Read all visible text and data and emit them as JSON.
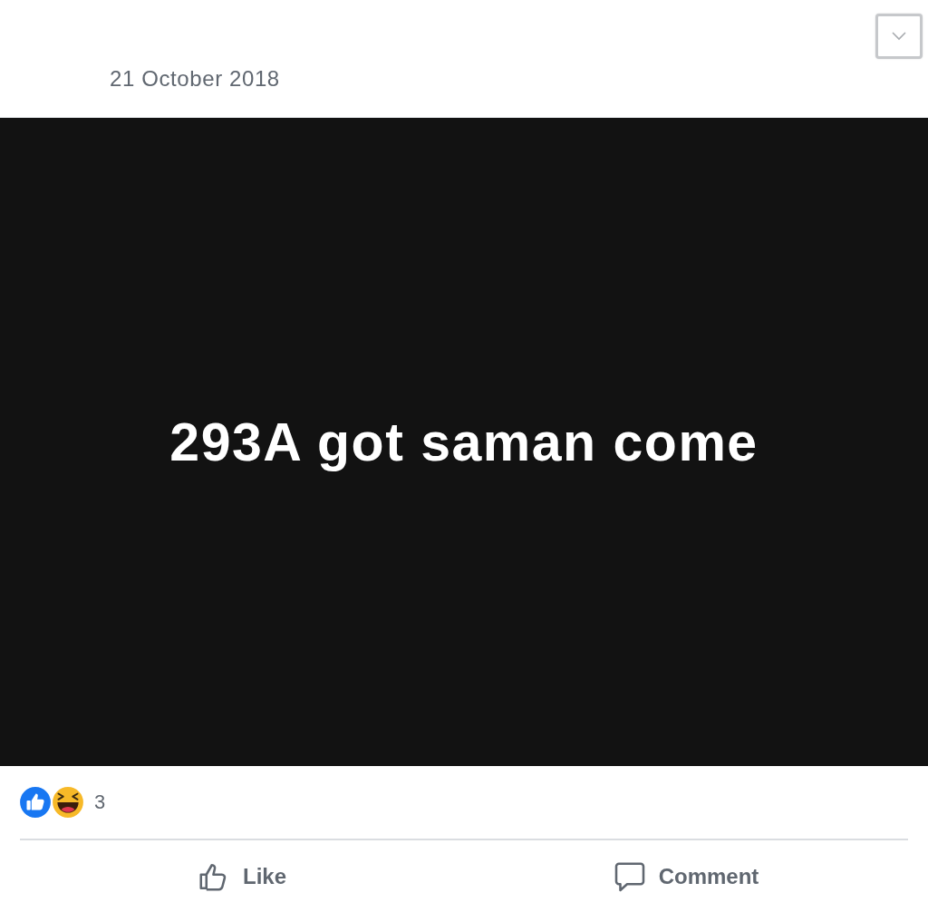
{
  "post": {
    "date": "21 October 2018",
    "text": "293A got saman come"
  },
  "reactions": {
    "types": [
      {
        "kind": "like"
      },
      {
        "kind": "haha"
      }
    ],
    "count": "3"
  },
  "actions": [
    {
      "kind": "like",
      "label": "Like"
    },
    {
      "kind": "comment",
      "label": "Comment"
    }
  ]
}
